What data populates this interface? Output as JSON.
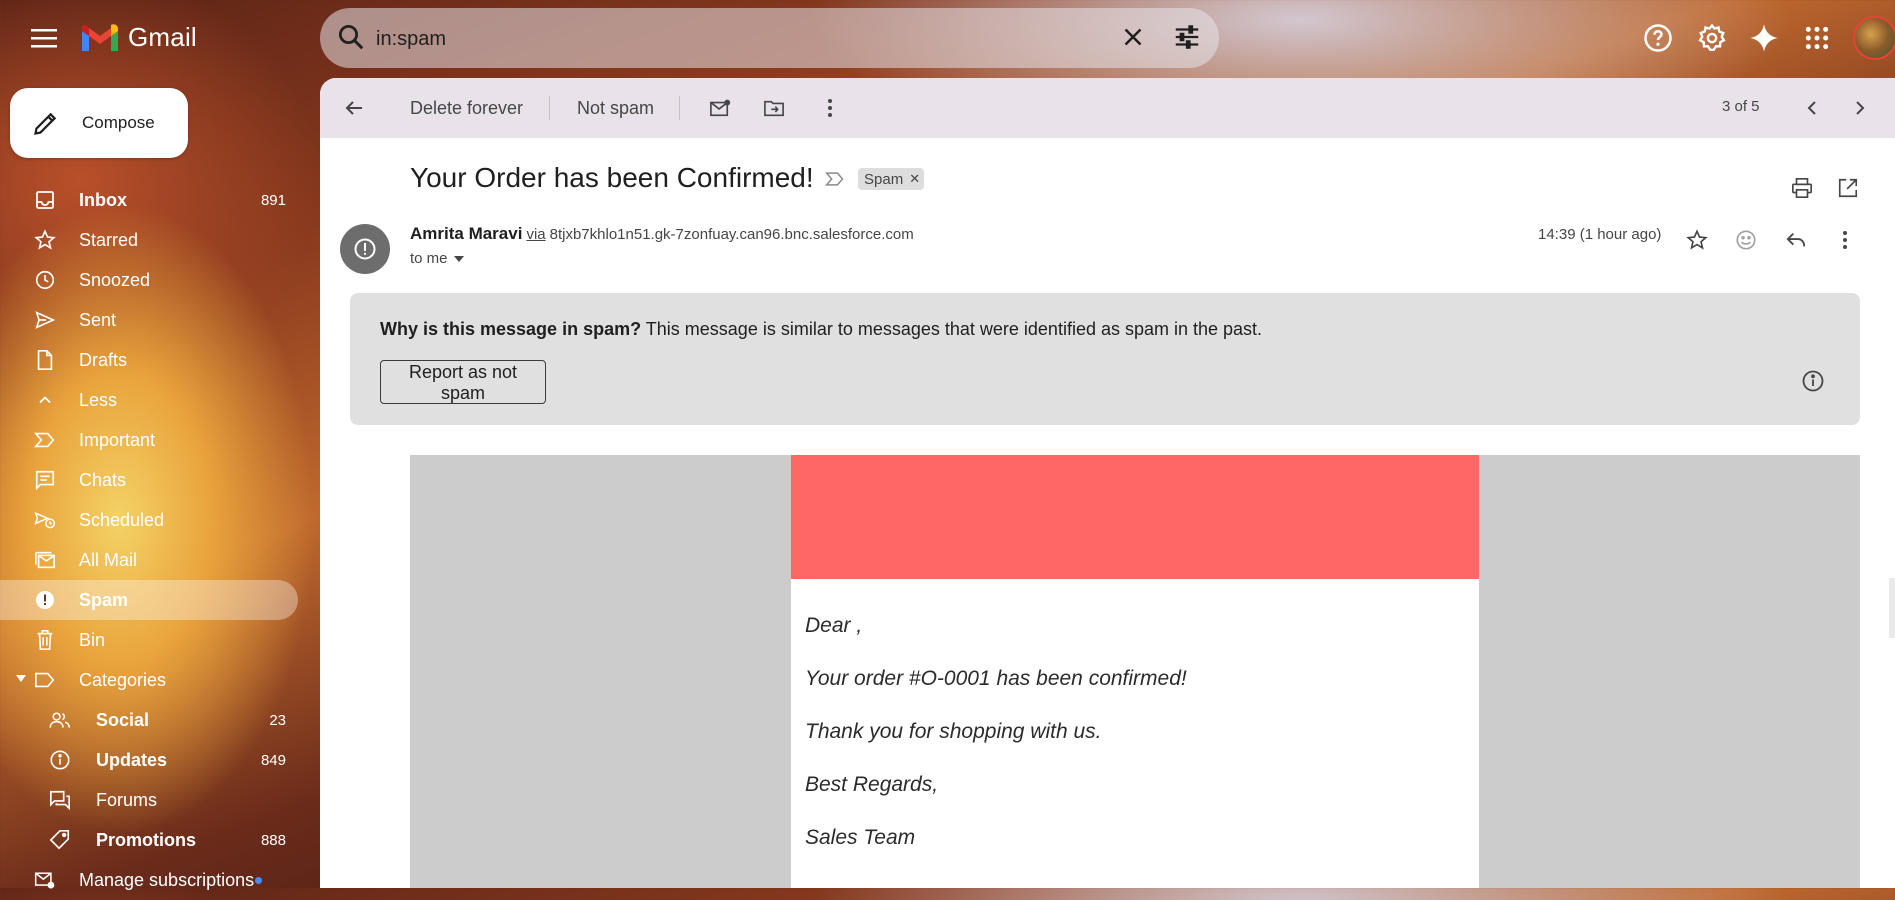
{
  "app": {
    "name": "Gmail"
  },
  "search": {
    "value": "in:spam"
  },
  "compose": {
    "label": "Compose"
  },
  "sidebar": {
    "items": [
      {
        "label": "Inbox",
        "count": "891",
        "icon": "inbox-icon",
        "bold": true
      },
      {
        "label": "Starred",
        "count": "",
        "icon": "star-icon"
      },
      {
        "label": "Snoozed",
        "count": "",
        "icon": "clock-icon"
      },
      {
        "label": "Sent",
        "count": "",
        "icon": "send-icon"
      },
      {
        "label": "Drafts",
        "count": "",
        "icon": "draft-icon"
      },
      {
        "label": "Less",
        "count": "",
        "icon": "chevron-up-icon"
      },
      {
        "label": "Important",
        "count": "",
        "icon": "important-icon"
      },
      {
        "label": "Chats",
        "count": "",
        "icon": "chat-icon"
      },
      {
        "label": "Scheduled",
        "count": "",
        "icon": "scheduled-icon"
      },
      {
        "label": "All Mail",
        "count": "",
        "icon": "all-mail-icon"
      },
      {
        "label": "Spam",
        "count": "",
        "icon": "spam-icon",
        "active": true
      },
      {
        "label": "Bin",
        "count": "",
        "icon": "trash-icon"
      },
      {
        "label": "Categories",
        "count": "",
        "icon": "label-icon"
      }
    ],
    "categories": [
      {
        "label": "Social",
        "count": "23",
        "icon": "people-icon"
      },
      {
        "label": "Updates",
        "count": "849",
        "icon": "info-icon"
      },
      {
        "label": "Forums",
        "count": "",
        "icon": "forum-icon"
      },
      {
        "label": "Promotions",
        "count": "888",
        "icon": "tag-icon"
      }
    ],
    "manage": {
      "label": "Manage subscriptions",
      "icon": "manage-subscriptions-icon"
    }
  },
  "toolbar": {
    "delete_forever": "Delete forever",
    "not_spam": "Not spam",
    "pager": "3 of 5"
  },
  "message": {
    "subject": "Your Order has been Confirmed!",
    "label_chip": "Spam",
    "sender_name": "Amrita Maravi",
    "via": "via",
    "sender_domain": "8tjxb7khlo1n51.gk-7zonfuay.can96.bnc.salesforce.com",
    "to": "to me",
    "time": "14:39 (1 hour ago)"
  },
  "spam_notice": {
    "question": "Why is this message in spam?",
    "explanation": "This message is similar to messages that were identified as spam in the past.",
    "report_button": "Report as not spam"
  },
  "email_body": {
    "banner_color": "#ff6666",
    "lines": [
      "Dear ,",
      "Your order #O-0001 has been confirmed!",
      "Thank you for shopping with us.",
      "Best Regards,",
      "Sales Team"
    ]
  }
}
